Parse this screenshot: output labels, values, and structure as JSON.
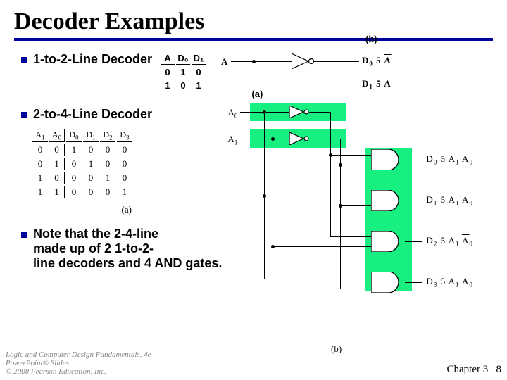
{
  "title": "Decoder Examples",
  "bullet1": "1-to-2-Line Decoder",
  "bullet2": "2-to-4-Line Decoder",
  "bullet3_l1": "Note that the 2-4-line",
  "bullet3_l2": "made up of  2 1-to-2-",
  "bullet3_l3": "line decoders and 4 AND gates.",
  "t1": {
    "h": [
      "A",
      "D₀",
      "D₁"
    ],
    "r": [
      [
        "0",
        "1",
        "0"
      ],
      [
        "1",
        "0",
        "1"
      ]
    ]
  },
  "t2": {
    "h": [
      "A",
      "A",
      "D",
      "D",
      "D",
      "D"
    ],
    "hs": [
      "1",
      "0",
      "0",
      "1",
      "2",
      "3"
    ],
    "r": [
      [
        "0",
        "0",
        "1",
        "0",
        "0",
        "0"
      ],
      [
        "0",
        "1",
        "0",
        "1",
        "0",
        "0"
      ],
      [
        "1",
        "0",
        "0",
        "0",
        "1",
        "0"
      ],
      [
        "1",
        "1",
        "0",
        "0",
        "0",
        "1"
      ]
    ],
    "caption": "(a)"
  },
  "fig1": {
    "A": "A",
    "D0a": "D",
    "D0b": "0",
    "eq": "5",
    "Abar": "A",
    "D1a": "D",
    "D1b": "1",
    "eq2": "5",
    "A2": "A",
    "caption": "(b)"
  },
  "fig2": {
    "A0": "A",
    "A0s": "0",
    "A1": "A",
    "A1s": "1",
    "caption_a": "(a)",
    "caption_b": "(b)",
    "outs": [
      {
        "d": "D",
        "ds": "0",
        "eq": "5",
        "t1": "A",
        "t1s": "1",
        "t1bar": true,
        "t2": "A",
        "t2s": "0",
        "t2bar": true
      },
      {
        "d": "D",
        "ds": "1",
        "eq": "5",
        "t1": "A",
        "t1s": "1",
        "t1bar": true,
        "t2": "A",
        "t2s": "0",
        "t2bar": false
      },
      {
        "d": "D",
        "ds": "2",
        "eq": "5",
        "t1": "A",
        "t1s": "1",
        "t1bar": false,
        "t2": "A",
        "t2s": "0",
        "t2bar": true
      },
      {
        "d": "D",
        "ds": "3",
        "eq": "5",
        "t1": "A",
        "t1s": "1",
        "t1bar": false,
        "t2": "A",
        "t2s": "0",
        "t2bar": false
      }
    ]
  },
  "footer": {
    "credit": "Logic and Computer Design Fundamentals, 4e\nPowerPoint® Slides\n© 2008 Pearson Education, Inc.",
    "chapter": "Chapter 3",
    "page": "8"
  }
}
